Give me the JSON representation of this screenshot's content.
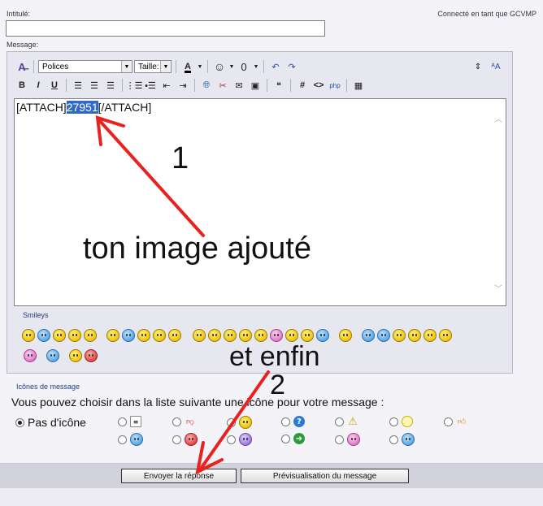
{
  "header": {
    "title_label": "Intitulé:",
    "title_value": "",
    "connected_text": "Connecté en tant que GCVMP",
    "message_label": "Message:"
  },
  "toolbar": {
    "font_select": "Polices",
    "size_select": "Taille:",
    "bold": "B",
    "italic": "I",
    "underline": "U",
    "hash": "#",
    "code": "<>"
  },
  "editor": {
    "text_before": "[ATTACH]",
    "text_selected": "27951",
    "text_after": "[/ATTACH]"
  },
  "smileys": {
    "label": "Smileys"
  },
  "message_icons": {
    "label": "Icônes de message",
    "instruction": "Vous pouvez choisir dans la liste suivante une icône pour votre message :",
    "no_icon_label": "Pas d'icône"
  },
  "buttons": {
    "submit": "Envoyer la réponse",
    "preview": "Prévisualisation du message"
  },
  "annotations": {
    "step1_number": "1",
    "step1_text": "ton image ajouté",
    "step2_text": "et enfin",
    "step2_number": "2"
  },
  "colors": {
    "arrow": "#e8231f",
    "selection": "#316ac5",
    "label_blue": "#22407a"
  }
}
